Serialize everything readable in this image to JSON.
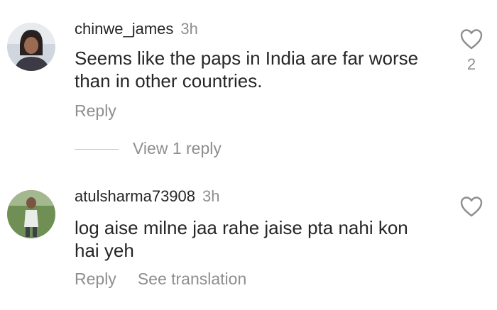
{
  "comments": [
    {
      "username": "chinwe_james",
      "time": "3h",
      "text": "Seems like the paps in India are far worse than in other countries.",
      "reply_label": "Reply",
      "like_count": "2",
      "view_replies_label": "View 1 reply"
    },
    {
      "username": "atulsharma73908",
      "time": "3h",
      "text": "log aise milne jaa rahe jaise pta nahi kon hai yeh",
      "reply_label": "Reply",
      "translate_label": "See translation"
    }
  ],
  "icons": {
    "like": "heart-outline-icon"
  },
  "colors": {
    "primary_text": "#262626",
    "secondary_text": "#8e8e8e",
    "divider": "#c7c7c7"
  }
}
